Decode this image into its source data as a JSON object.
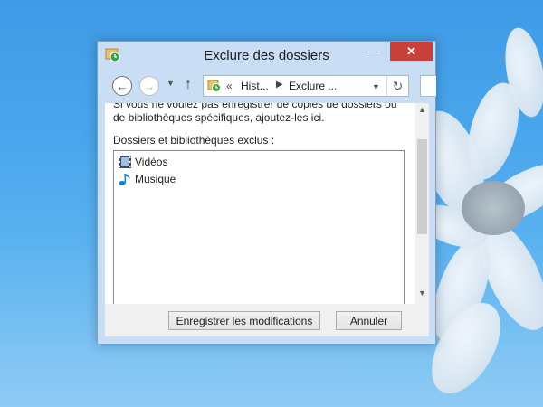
{
  "window": {
    "title": "Exclure des dossiers",
    "controls": {
      "minimize": "—",
      "maximize": "☐",
      "close": "✕"
    }
  },
  "navigation": {
    "back_icon": "arrow-left-icon",
    "forward_icon": "arrow-right-icon",
    "recent_icon": "chevron-down-icon",
    "up_icon": "arrow-up-icon",
    "address": {
      "separator": "«",
      "crumbs": [
        "Hist...",
        "Exclure ..."
      ],
      "arrow": "▶",
      "dropdown": "▼",
      "refresh": "↻"
    }
  },
  "content": {
    "intro": "Si vous ne voulez pas enregistrer de copies de dossiers ou de bibliothèques spécifiques, ajoutez-les ici.",
    "list_label": "Dossiers et bibliothèques exclus :",
    "items": [
      {
        "label": "Vidéos",
        "icon": "video-library-icon"
      },
      {
        "label": "Musique",
        "icon": "music-library-icon"
      }
    ],
    "scroll": {
      "up": "▲",
      "down": "▼"
    }
  },
  "footer": {
    "save_label": "Enregistrer les modifications",
    "cancel_label": "Annuler"
  },
  "colors": {
    "close_button": "#c7403a",
    "window_frame": "#c9def5",
    "desktop": "#4aa6ec"
  }
}
